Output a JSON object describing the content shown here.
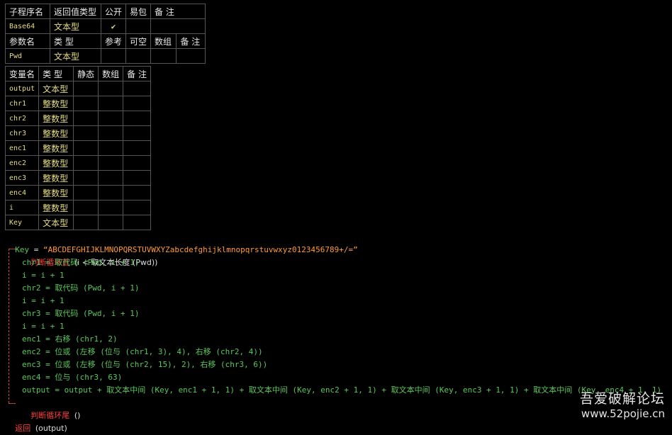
{
  "sub_table": {
    "headers": [
      "子程序名",
      "返回值类型",
      "公开",
      "易包",
      "备 注"
    ],
    "row": {
      "name": "Base64",
      "type": "文本型",
      "public": "✔",
      "easy": "",
      "note": ""
    },
    "param_headers": [
      "参数名",
      "类 型",
      "参考",
      "可空",
      "数组",
      "备 注"
    ],
    "params": [
      {
        "name": "Pwd",
        "type": "文本型"
      }
    ]
  },
  "var_table": {
    "headers": [
      "变量名",
      "类 型",
      "静态",
      "数组",
      "备 注"
    ],
    "rows": [
      {
        "name": "output",
        "type": "文本型"
      },
      {
        "name": "chr1",
        "type": "整数型"
      },
      {
        "name": "chr2",
        "type": "整数型"
      },
      {
        "name": "chr3",
        "type": "整数型"
      },
      {
        "name": "enc1",
        "type": "整数型"
      },
      {
        "name": "enc2",
        "type": "整数型"
      },
      {
        "name": "enc3",
        "type": "整数型"
      },
      {
        "name": "enc4",
        "type": "整数型"
      },
      {
        "name": "i",
        "type": "整数型"
      },
      {
        "name": "Key",
        "type": "文本型"
      }
    ]
  },
  "code": {
    "key_line": {
      "var": "Key",
      "eq": "=",
      "value": "“ABCDEFGHIJKLMNOPQRSTUVWXYZabcdefghijklmnopqrstuvwxyz0123456789+/=”"
    },
    "loop_head": {
      "keyword": "判断循环首",
      "rest": "(i < 取文本长度 (Pwd))"
    },
    "body": [
      "chr1 = 取代码 (Pwd, i + 1)",
      "i = i + 1",
      "chr2 = 取代码 (Pwd, i + 1)",
      "i = i + 1",
      "chr3 = 取代码 (Pwd, i + 1)",
      "i = i + 1",
      "enc1 = 右移 (chr1, 2)",
      "enc2 = 位或 (左移 (位与 (chr1, 3), 4), 右移 (chr2, 4))",
      "enc3 = 位或 (左移 (位与 (chr2, 15), 2), 右移 (chr3, 6))",
      "enc4 = 位与 (chr3, 63)",
      "output = output + 取文本中间 (Key, enc1 + 1, 1) + 取文本中间 (Key, enc2 + 1, 1) + 取文本中间 (Key, enc3 + 1, 1) + 取文本中间 (Key, enc4 + 1, 1)"
    ],
    "loop_tail": {
      "keyword": "判断循环尾",
      "rest": "()"
    },
    "return_line": {
      "keyword": "返回",
      "rest": "(output)"
    }
  },
  "watermark": {
    "line1": "吾爱破解论坛",
    "line2": "www.52pojie.cn"
  },
  "colors": {
    "background": "#000000",
    "keyword": "#ff3b3b",
    "variable": "#5ac85a",
    "string": "#ff9a30",
    "type_text": "#e6dc82",
    "grid": "#555555"
  }
}
